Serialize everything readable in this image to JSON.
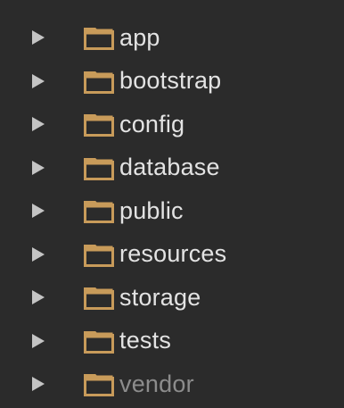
{
  "colors": {
    "background": "#2b2b2b",
    "text": "#e3e3e3",
    "text_dimmed": "#8c8c8c",
    "arrow": "#c4c4c4",
    "folder": "#c89b5a"
  },
  "icons": {
    "expand": "triangle-right-icon",
    "folder": "folder-icon"
  },
  "tree": {
    "items": [
      {
        "label": "app",
        "dimmed": false
      },
      {
        "label": "bootstrap",
        "dimmed": false
      },
      {
        "label": "config",
        "dimmed": false
      },
      {
        "label": "database",
        "dimmed": false
      },
      {
        "label": "public",
        "dimmed": false
      },
      {
        "label": "resources",
        "dimmed": false
      },
      {
        "label": "storage",
        "dimmed": false
      },
      {
        "label": "tests",
        "dimmed": false
      },
      {
        "label": "vendor",
        "dimmed": true
      }
    ]
  }
}
